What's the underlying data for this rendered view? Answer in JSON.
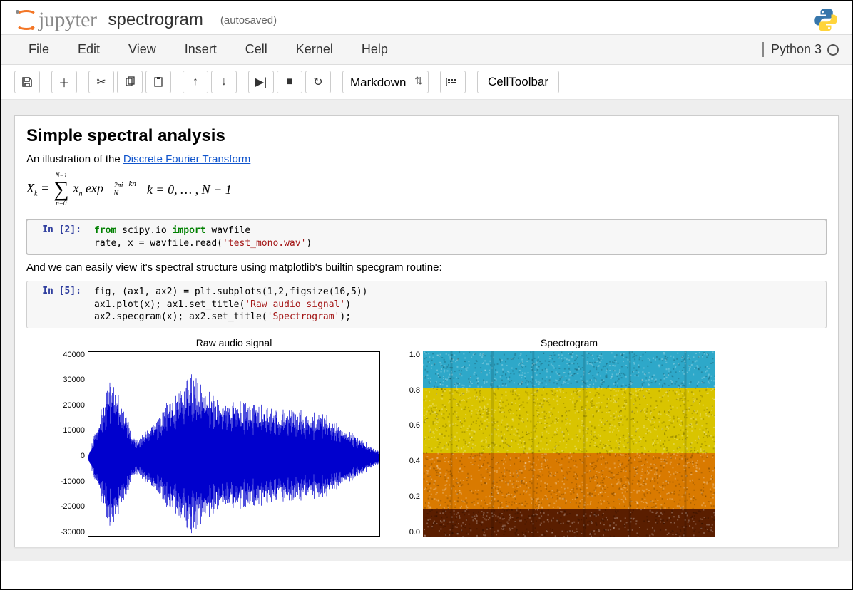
{
  "header": {
    "logo_text": "jupyter",
    "notebook_name": "spectrogram",
    "save_status": "(autosaved)"
  },
  "menubar": {
    "items": [
      "File",
      "Edit",
      "View",
      "Insert",
      "Cell",
      "Kernel",
      "Help"
    ],
    "kernel_name": "Python 3"
  },
  "toolbar": {
    "cell_type": "Markdown",
    "cell_toolbar_label": "CellToolbar"
  },
  "cells": {
    "heading": "Simple spectral analysis",
    "intro_prefix": "An illustration of the ",
    "intro_link": "Discrete Fourier Transform",
    "math_plain": "X_k = Σ_{n=0}^{N-1} x_n exp(−2πi/N · kn)   k = 0, … , N − 1",
    "cell2_prompt": "In [2]:",
    "cell2_code_html": "<span class='kw-green'>from</span> scipy.io <span class='kw-green'>import</span> wavfile\nrate, x = wavfile.read(<span class='kw-red'>'test_mono.wav'</span>)",
    "mid_text": "And we can easily view it's spectral structure using matplotlib's builtin specgram routine:",
    "cell5_prompt": "In [5]:",
    "cell5_code_html": "fig, (ax1, ax2) = plt.subplots(1,2,figsize(16,5))\nax1.plot(x); ax1.set_title(<span class='kw-red'>'Raw audio signal'</span>)\nax2.specgram(x); ax2.set_title(<span class='kw-red'>'Spectrogram'</span>);"
  },
  "chart_data": [
    {
      "type": "line",
      "title": "Raw audio signal",
      "xlabel": "",
      "ylabel": "",
      "ylim": [
        -30000,
        40000
      ],
      "yticks": [
        40000,
        30000,
        20000,
        10000,
        0,
        -10000,
        -20000,
        -30000
      ],
      "note": "dense audio waveform; amplitude envelope estimated",
      "envelope_pts": [
        [
          0,
          1000
        ],
        [
          60,
          29000
        ],
        [
          130,
          6000
        ],
        [
          280,
          30000
        ],
        [
          350,
          22000
        ],
        [
          500,
          18000
        ],
        [
          650,
          15000
        ],
        [
          800,
          2000
        ]
      ]
    },
    {
      "type": "heatmap",
      "title": "Spectrogram",
      "xlabel": "",
      "ylabel": "",
      "ylim": [
        0.0,
        1.0
      ],
      "yticks": [
        1.0,
        0.8,
        0.6,
        0.4,
        0.2,
        0.0
      ],
      "note": "spectrogram image; band intensities estimated by vertical fraction",
      "bands": [
        {
          "y0": 0.0,
          "y1": 0.15,
          "color": "#5a1e00"
        },
        {
          "y0": 0.15,
          "y1": 0.45,
          "color": "#d97a00"
        },
        {
          "y0": 0.45,
          "y1": 0.8,
          "color": "#d9c400"
        },
        {
          "y0": 0.8,
          "y1": 1.0,
          "color": "#2ea8c9"
        }
      ]
    }
  ]
}
